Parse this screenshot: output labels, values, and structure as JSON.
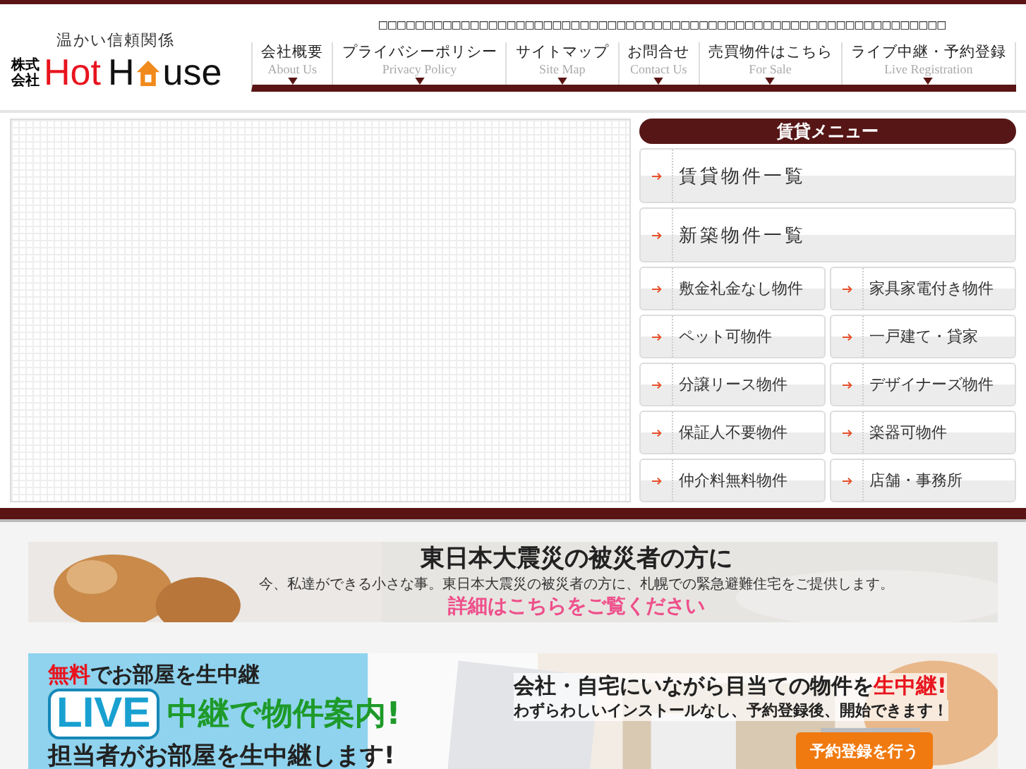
{
  "header": {
    "tagline": "温かい信頼関係",
    "logo_prefix": "株式会社",
    "logo_hot": "Hot",
    "logo_h": "H",
    "logo_use": "use",
    "notice": "□□□□□□□□□□□□□□□□□□□□□□□□□□□□□□□□□□□□□□□□□□□□□□□□□□□□□□□□□□□□□□"
  },
  "nav": [
    {
      "label": "会社概要",
      "sub": "About Us"
    },
    {
      "label": "プライバシーポリシー",
      "sub": "Privacy Policy"
    },
    {
      "label": "サイトマップ",
      "sub": "Site Map"
    },
    {
      "label": "お問合せ",
      "sub": "Contact Us"
    },
    {
      "label": "売買物件はこちら",
      "sub": "For Sale"
    },
    {
      "label": "ライブ中継・予約登録",
      "sub": "Live Registration"
    }
  ],
  "rental_menu": {
    "title": "賃貸メニュー",
    "wide_items": [
      "賃貸物件一覧",
      "新築物件一覧"
    ],
    "grid_items": [
      "敷金礼金なし物件",
      "家具家電付き物件",
      "ペット可物件",
      "一戸建て・貸家",
      "分譲リース物件",
      "デザイナーズ物件",
      "保証人不要物件",
      "楽器可物件",
      "仲介料無料物件",
      "店舗・事務所"
    ]
  },
  "disaster_banner": {
    "title": "東日本大震災の被災者の方に",
    "text": "今、私達ができる小さな事。東日本大震災の被災者の方に、札幌での緊急避難住宅をご提供します。",
    "link": "詳細はこちらをご覧ください"
  },
  "live_banner": {
    "free": "無料",
    "free_rest": "でお部屋を生中継",
    "live": "LIVE",
    "headline": "中継で物件案内!",
    "sub": "担当者がお部屋を生中継します!",
    "right_title": "会社・自宅にいながら目当ての物件を",
    "right_title_em": "生中継!",
    "right_text": "わずらわしいインストールなし、予約登録後、開始できます！",
    "button": "予約登録を行う"
  }
}
